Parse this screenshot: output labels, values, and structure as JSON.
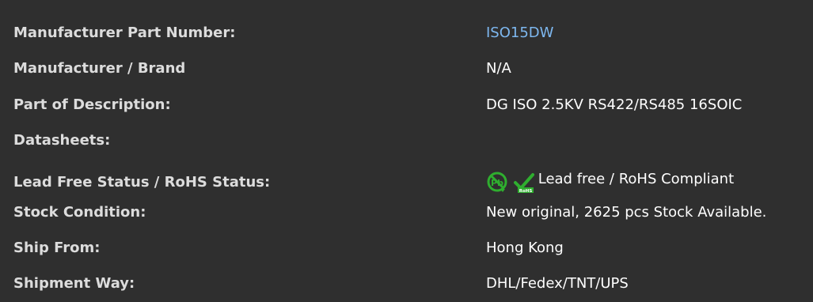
{
  "rows": [
    {
      "label": "Manufacturer Part Number:",
      "value": "ISO15DW"
    },
    {
      "label": "Manufacturer / Brand",
      "value": "N/A"
    },
    {
      "label": "Part of Description:",
      "value": "DG ISO 2.5KV RS422/RS485 16SOIC"
    },
    {
      "label": "Datasheets:",
      "value": ""
    },
    {
      "label": "Lead Free Status / RoHS Status:",
      "value": "Lead free / RoHS Compliant"
    },
    {
      "label": "Stock Condition:",
      "value": "New original, 2625 pcs Stock Available."
    },
    {
      "label": "Ship From:",
      "value": "Hong Kong"
    },
    {
      "label": "Shipment Way:",
      "value": "DHL/Fedex/TNT/UPS"
    }
  ],
  "icons": {
    "lead_free": "lead-free-icon",
    "rohs": "rohs-check-icon",
    "rohs_badge_text": "RoHS"
  },
  "colors": {
    "background": "#2f2f2f",
    "label": "#dcdcdc",
    "value": "#ffffff",
    "link": "#7eb8f0",
    "green": "#2fae2f"
  }
}
